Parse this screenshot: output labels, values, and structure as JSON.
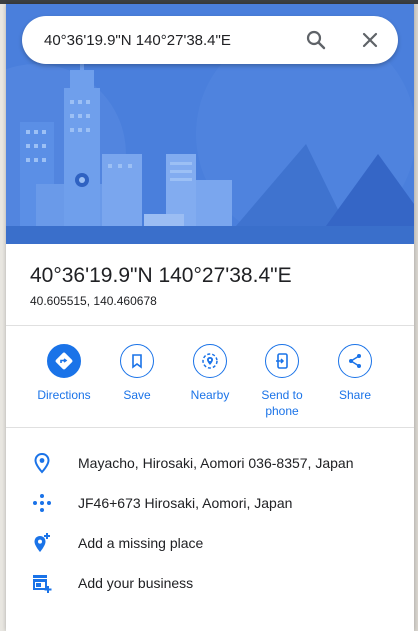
{
  "search": {
    "value": "40°36'19.9\"N 140°27'38.4\"E"
  },
  "place": {
    "title": "40°36'19.9\"N 140°27'38.4\"E",
    "decimal_coords": "40.605515, 140.460678"
  },
  "actions": [
    {
      "label": "Directions",
      "icon": "directions-icon"
    },
    {
      "label": "Save",
      "icon": "bookmark-icon"
    },
    {
      "label": "Nearby",
      "icon": "nearby-icon"
    },
    {
      "label": "Send to phone",
      "icon": "send-to-phone-icon"
    },
    {
      "label": "Share",
      "icon": "share-icon"
    }
  ],
  "info_rows": [
    {
      "text": "Mayacho, Hirosaki, Aomori 036-8357, Japan",
      "icon": "location-pin-icon"
    },
    {
      "text": "JF46+673 Hirosaki, Aomori, Japan",
      "icon": "plus-code-icon"
    },
    {
      "text": "Add a missing place",
      "icon": "add-place-icon"
    },
    {
      "text": "Add your business",
      "icon": "add-business-icon"
    }
  ],
  "colors": {
    "accent": "#1a73e8",
    "hero_bg": "#4a7fdc",
    "text": "#202124"
  }
}
